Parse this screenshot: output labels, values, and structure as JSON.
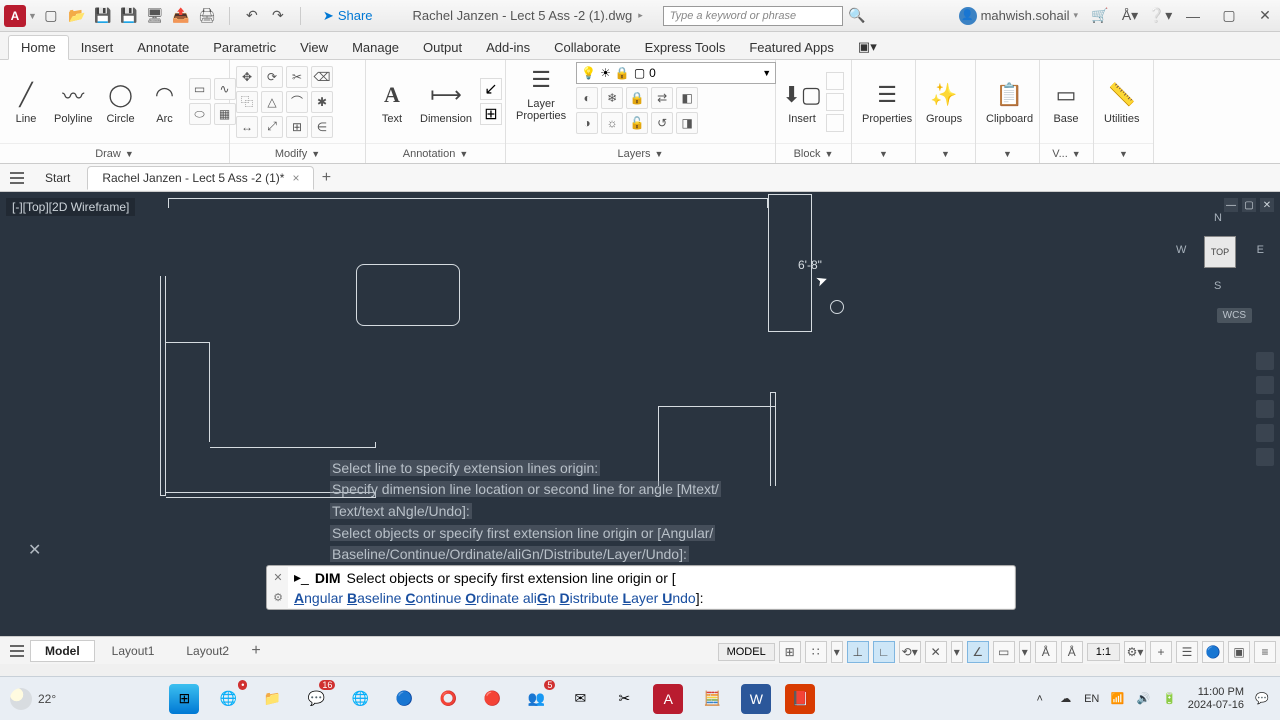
{
  "titlebar": {
    "app_initial": "A",
    "share": "Share",
    "filename": "Rachel Janzen - Lect 5 Ass -2 (1).dwg",
    "search_placeholder": "Type a keyword or phrase",
    "username": "mahwish.sohail"
  },
  "menus": [
    "Home",
    "Insert",
    "Annotate",
    "Parametric",
    "View",
    "Manage",
    "Output",
    "Add-ins",
    "Collaborate",
    "Express Tools",
    "Featured Apps"
  ],
  "ribbon": {
    "draw": {
      "line": "Line",
      "polyline": "Polyline",
      "circle": "Circle",
      "arc": "Arc",
      "title": "Draw"
    },
    "modify": {
      "title": "Modify"
    },
    "annotation": {
      "text": "Text",
      "dimension": "Dimension",
      "title": "Annotation"
    },
    "layers": {
      "btn": "Layer\nProperties",
      "current": "0",
      "title": "Layers"
    },
    "block": {
      "insert": "Insert",
      "title": "Block"
    },
    "panels": {
      "properties": "Properties",
      "groups": "Groups",
      "clipboard": "Clipboard",
      "base": "Base",
      "utilities": "Utilities",
      "view": "V..."
    }
  },
  "filetabs": {
    "start": "Start",
    "file": "Rachel Janzen - Lect 5 Ass -2 (1)*"
  },
  "canvas": {
    "viewlabel": "[-][Top][2D Wireframe]",
    "dimension": "6'-8\"",
    "viewcube": {
      "top": "TOP",
      "n": "N",
      "s": "S",
      "e": "E",
      "w": "W"
    },
    "wcs": "WCS"
  },
  "cmd_history": {
    "l1": "Select line to specify extension lines origin:",
    "l2": "Specify dimension line location or second line for angle [Mtext/",
    "l3": "Text/text aNgle/Undo]:",
    "l4": "Select objects or specify first extension line origin or [Angular/",
    "l5": "Baseline/Continue/Ordinate/aliGn/Distribute/Layer/Undo]:"
  },
  "cmd_input": {
    "cmd": "DIM",
    "prompt": "Select objects or specify first extension line origin or [",
    "opts": [
      "Angular",
      "Baseline",
      "Continue",
      "Ordinate",
      "aliGn",
      "Distribute",
      "Layer",
      "Undo"
    ],
    "tail": "]:"
  },
  "modeltabs": [
    "Model",
    "Layout1",
    "Layout2"
  ],
  "statusbar": {
    "model": "MODEL",
    "scale": "1:1"
  },
  "taskbar": {
    "temp": "22°",
    "time": "11:00 PM",
    "date": "2024-07-16",
    "badge_teams": "16",
    "badge_teams2": "5"
  }
}
